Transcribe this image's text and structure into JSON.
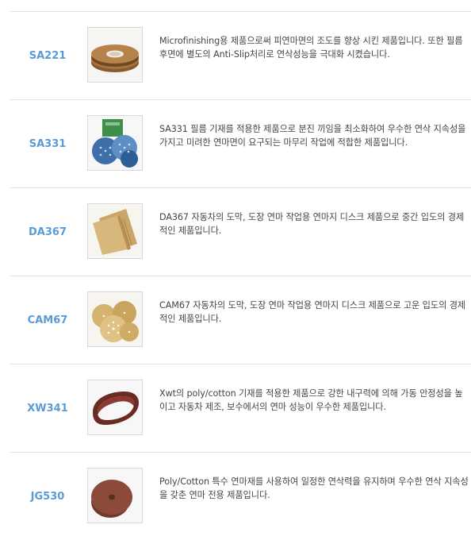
{
  "products": [
    {
      "code": "SA221",
      "image_icon": "tape-roll-icon",
      "description": "Microfinishing용 제품으로써 피연마면의 조도를 향상 시킨 제품입니다. 또한 필름 후면에 별도의 Anti-Slip처리로 연삭성능을 극대화 시켰습니다."
    },
    {
      "code": "SA331",
      "image_icon": "blue-discs-icon",
      "description": "SA331 필름 기재를 적용한 제품으로 분진 끼임을 최소화하여 우수한 연삭 지속성을 가지고 미려한 연마면이 요구되는 마무리 작업에 적합한 제품입니다."
    },
    {
      "code": "DA367",
      "image_icon": "sandpaper-sheet-icon",
      "description": "DA367 자동차의 도막, 도장 연마 작업용 연마지 디스크 제품으로 중간 입도의 경제적인 제품입니다."
    },
    {
      "code": "CAM67",
      "image_icon": "gold-discs-icon",
      "description": "CAM67 자동차의 도막, 도장 연마 작업용 연마지 디스크 제품으로 고운 입도의 경제적인 제품입니다."
    },
    {
      "code": "XW341",
      "image_icon": "sanding-belt-icon",
      "description": "Xwt의 poly/cotton 기재를 적용한 제품으로 강한 내구력에 의해 가동 안정성을 높이고 자동차 제조, 보수에서의 연마 성능이 우수한 제품입니다."
    },
    {
      "code": "JG530",
      "image_icon": "brown-disc-icon",
      "description": "Poly/Cotton 특수 연마재를 사용하여 일정한 연삭력을 유지하며 우수한 연삭 지속성을 갖춘 연마 전용 제품입니다."
    }
  ]
}
